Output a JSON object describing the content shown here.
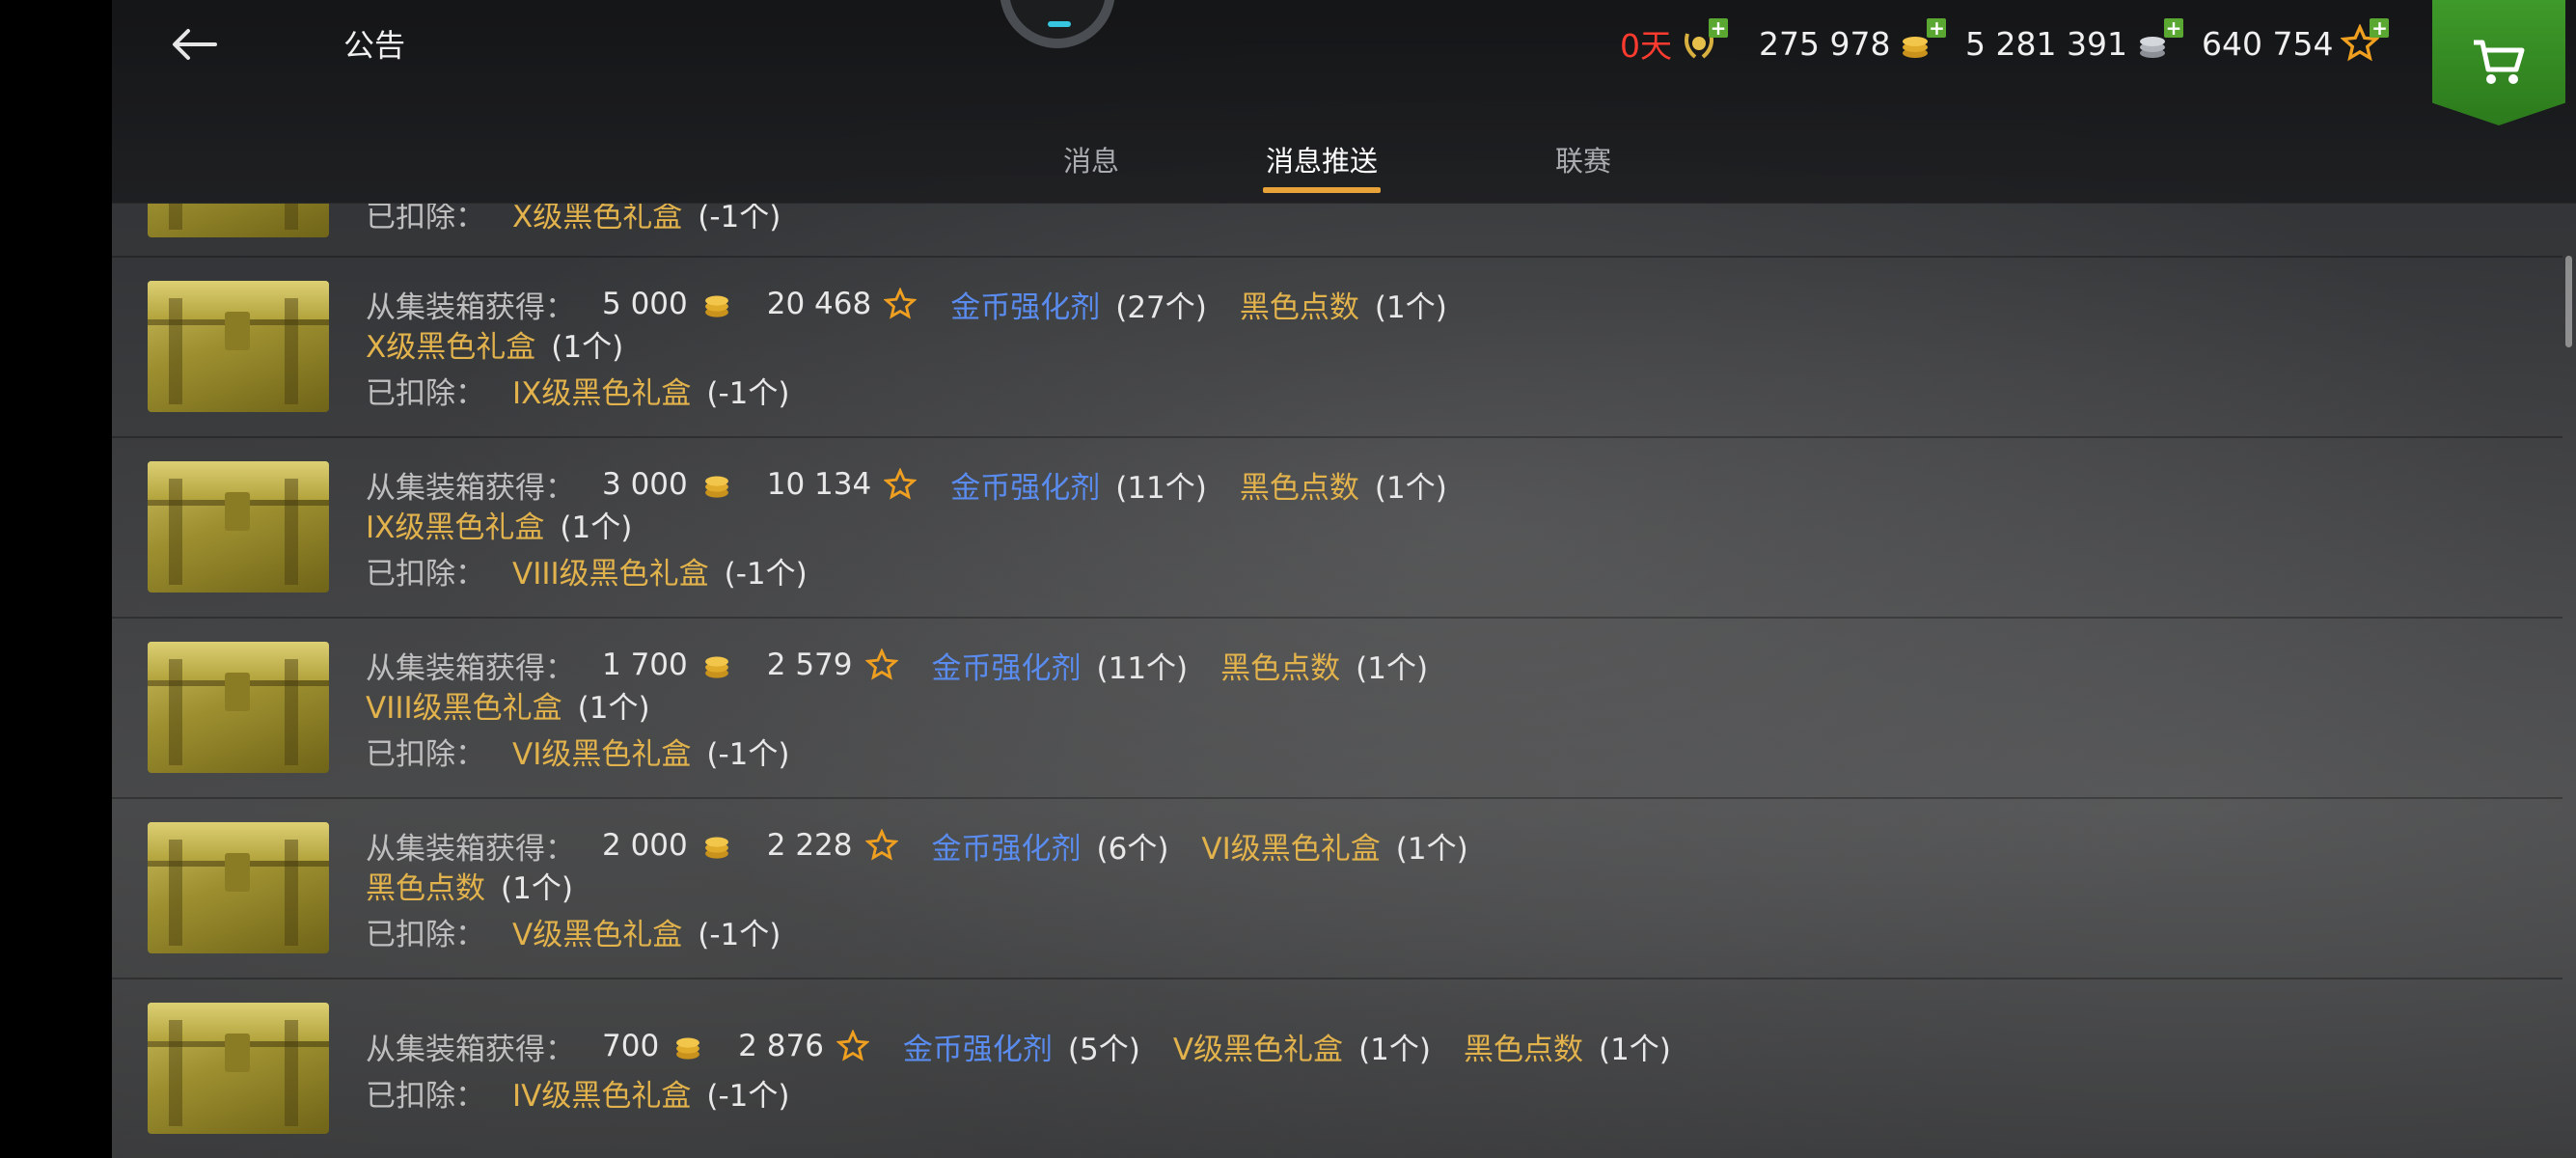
{
  "header": {
    "title": "公告",
    "currencies": [
      {
        "value": "0天",
        "icon": "premium-laurel-icon",
        "color": "#ff3b30"
      },
      {
        "value": "275 978",
        "icon": "gold-coins-icon"
      },
      {
        "value": "5 281 391",
        "icon": "silver-coins-icon"
      },
      {
        "value": "640 754",
        "icon": "star-icon"
      }
    ],
    "plus": "+",
    "cart_icon": "cart-icon"
  },
  "tabs": [
    {
      "label": "消息",
      "active": false
    },
    {
      "label": "消息推送",
      "active": true
    },
    {
      "label": "联赛",
      "active": false
    }
  ],
  "labels": {
    "obtained": "从集装箱获得：",
    "deducted": "已扣除："
  },
  "partial_row": {
    "text_label": "已扣除：",
    "item": "X级黑色礼盒",
    "qty": "(-1个)"
  },
  "rows": [
    {
      "gold": "5 000",
      "stars": "20 468",
      "items_line1": [
        {
          "name": "金币强化剂",
          "qty": "(27个)",
          "color": "blue"
        },
        {
          "name": "黑色点数",
          "qty": "(1个)",
          "color": "gold"
        }
      ],
      "items_line2": [
        {
          "name": "X级黑色礼盒",
          "qty": "(1个)",
          "color": "gold"
        }
      ],
      "deducted": {
        "name": "IX级黑色礼盒",
        "qty": "(-1个)"
      }
    },
    {
      "gold": "3 000",
      "stars": "10 134",
      "items_line1": [
        {
          "name": "金币强化剂",
          "qty": "(11个)",
          "color": "blue"
        },
        {
          "name": "黑色点数",
          "qty": "(1个)",
          "color": "gold"
        }
      ],
      "items_line2": [
        {
          "name": "IX级黑色礼盒",
          "qty": "(1个)",
          "color": "gold"
        }
      ],
      "deducted": {
        "name": "VIII级黑色礼盒",
        "qty": "(-1个)"
      }
    },
    {
      "gold": "1 700",
      "stars": "2 579",
      "items_line1": [
        {
          "name": "金币强化剂",
          "qty": "(11个)",
          "color": "blue"
        },
        {
          "name": "黑色点数",
          "qty": "(1个)",
          "color": "gold"
        }
      ],
      "items_line2": [
        {
          "name": "VIII级黑色礼盒",
          "qty": "(1个)",
          "color": "gold"
        }
      ],
      "deducted": {
        "name": "VI级黑色礼盒",
        "qty": "(-1个)"
      }
    },
    {
      "gold": "2 000",
      "stars": "2 228",
      "items_line1": [
        {
          "name": "金币强化剂",
          "qty": "(6个)",
          "color": "blue"
        },
        {
          "name": "VI级黑色礼盒",
          "qty": "(1个)",
          "color": "gold"
        }
      ],
      "items_line2": [
        {
          "name": "黑色点数",
          "qty": "(1个)",
          "color": "gold"
        }
      ],
      "deducted": {
        "name": "V级黑色礼盒",
        "qty": "(-1个)"
      }
    },
    {
      "gold": "700",
      "stars": "2 876",
      "items_line1": [
        {
          "name": "金币强化剂",
          "qty": "(5个)",
          "color": "blue"
        },
        {
          "name": "V级黑色礼盒",
          "qty": "(1个)",
          "color": "gold"
        },
        {
          "name": "黑色点数",
          "qty": "(1个)",
          "color": "gold"
        }
      ],
      "items_line2": [],
      "deducted": {
        "name": "IV级黑色礼盒",
        "qty": "(-1个)"
      }
    }
  ]
}
